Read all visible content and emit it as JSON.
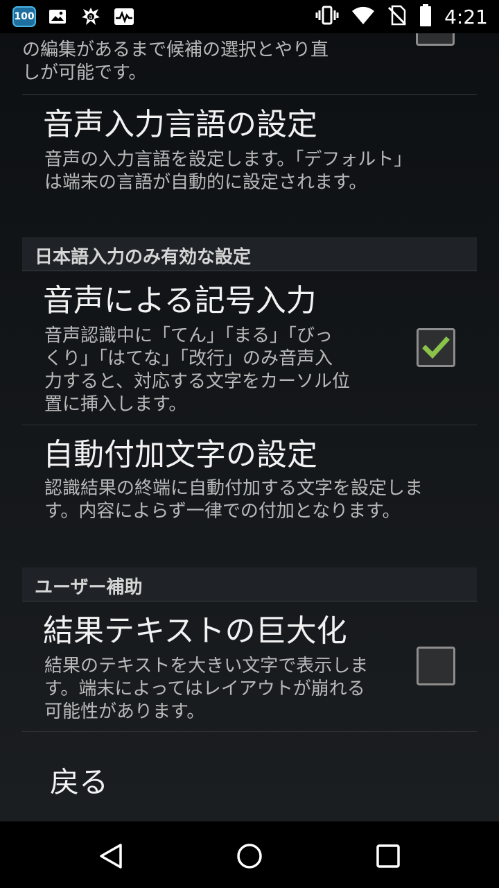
{
  "status_bar": {
    "badge": "100",
    "time": "4:21",
    "icons_left": [
      "battery-saver-badge-icon",
      "image-icon",
      "avast-icon",
      "activity-icon"
    ],
    "icons_right": [
      "vibrate-icon",
      "wifi-icon",
      "no-sim-icon",
      "battery-icon"
    ]
  },
  "partial_item": {
    "summary_line1": "の編集があるまで候補の選択とやり直",
    "summary_line2": "しが可能です。",
    "checked": false
  },
  "voice_language": {
    "title": "音声入力言語の設定",
    "summary_line1": "音声の入力言語を設定します。「デフォルト」",
    "summary_line2": "は端末の言語が自動的に設定されます。"
  },
  "category_japanese": {
    "label": "日本語入力のみ有効な設定"
  },
  "voice_symbol": {
    "title": "音声による記号入力",
    "summary_line1": "音声認識中に「てん」「まる」「びっ",
    "summary_line2": "くり」「はてな」「改行」のみ音声入",
    "summary_line3": "力すると、対応する文字をカーソル位",
    "summary_line4": "置に挿入します。",
    "checked": true
  },
  "auto_append": {
    "title": "自動付加文字の設定",
    "summary_line1": "認識結果の終端に自動付加する文字を設定しま",
    "summary_line2": "す。内容によらず一律での付加となります。"
  },
  "category_accessibility": {
    "label": "ユーザー補助"
  },
  "large_text": {
    "title": "結果テキストの巨大化",
    "summary_line1": "結果のテキストを大きい文字で表示しま",
    "summary_line2": "す。端末によってはレイアウトが崩れる",
    "summary_line3": "可能性があります。",
    "checked": false
  },
  "back_item": {
    "label": "戻る"
  },
  "nav_bar": {
    "buttons": [
      "back-icon",
      "home-icon",
      "recents-icon"
    ]
  },
  "colors": {
    "check_accent": "#8bc34a",
    "category_bg": "#1f2327"
  }
}
